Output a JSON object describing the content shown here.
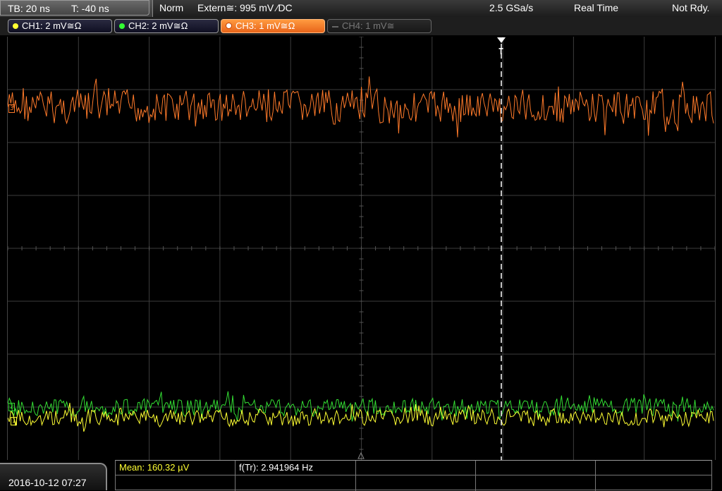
{
  "topbar": {
    "timebase": "TB: 20 ns",
    "trigger_time": "T: -40 ns",
    "acq_mode": "Norm",
    "trigger_source": "Extern≅: 995 mV ∕DC",
    "sample_rate": "2.5 GSa/s",
    "mode": "Real Time",
    "status": "Not Rdy."
  },
  "channels": [
    {
      "label": "CH1: 2 mV≅Ω",
      "color": "#ffff33",
      "state": "on"
    },
    {
      "label": "CH2: 2 mV≅Ω",
      "color": "#33ff33",
      "state": "on"
    },
    {
      "label": "CH3: 1 mV≅Ω",
      "color": "#ff8a3c",
      "state": "selected"
    },
    {
      "label": "CH4: 1 mV≅",
      "color": "#666666",
      "state": "off"
    }
  ],
  "screen": {
    "trigger_marker": "T",
    "ch3_marker": "3",
    "ch2_marker": "2",
    "ch1_marker": "1",
    "trace_colors": {
      "ch1": "#ffff33",
      "ch2": "#33dd33",
      "ch3": "#ff7a2a"
    },
    "grid_color": "#3c3c3c"
  },
  "bottom": {
    "datetime": "2016-10-12 07:27",
    "meas1_label": "Mean: 160.32 µV",
    "meas2_label": "f(Tr): 2.941964 Hz"
  }
}
